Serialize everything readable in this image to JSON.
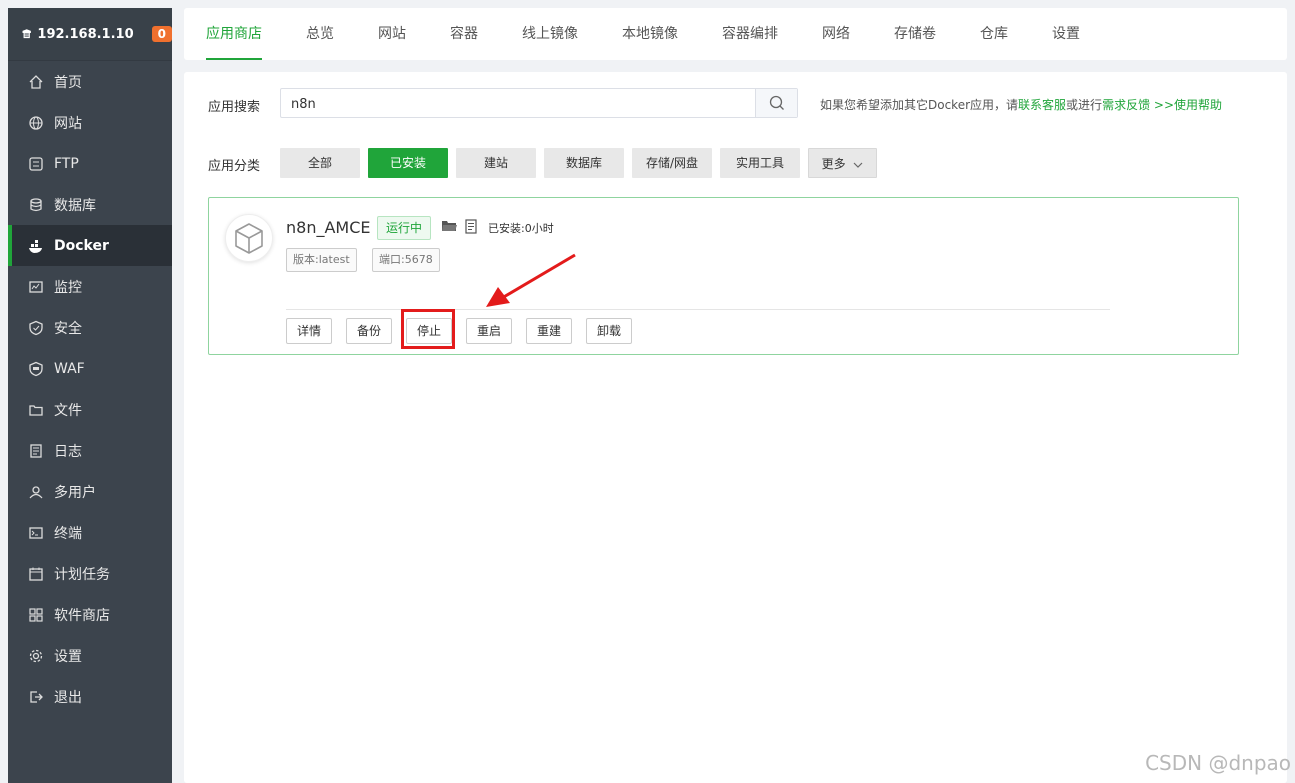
{
  "sidebar": {
    "ip": "192.168.1.10",
    "badge": "0",
    "items": [
      {
        "label": "首页",
        "icon": "home-icon"
      },
      {
        "label": "网站",
        "icon": "globe-icon"
      },
      {
        "label": "FTP",
        "icon": "ftp-icon"
      },
      {
        "label": "数据库",
        "icon": "database-icon"
      },
      {
        "label": "Docker",
        "icon": "docker-icon",
        "active": true
      },
      {
        "label": "监控",
        "icon": "monitor-icon"
      },
      {
        "label": "安全",
        "icon": "shield-icon"
      },
      {
        "label": "WAF",
        "icon": "waf-icon"
      },
      {
        "label": "文件",
        "icon": "folder-icon"
      },
      {
        "label": "日志",
        "icon": "log-icon"
      },
      {
        "label": "多用户",
        "icon": "users-icon"
      },
      {
        "label": "终端",
        "icon": "terminal-icon"
      },
      {
        "label": "计划任务",
        "icon": "calendar-icon"
      },
      {
        "label": "软件商店",
        "icon": "grid-icon"
      },
      {
        "label": "设置",
        "icon": "gear-icon"
      },
      {
        "label": "退出",
        "icon": "logout-icon"
      }
    ]
  },
  "tabs": [
    "应用商店",
    "总览",
    "网站",
    "容器",
    "线上镜像",
    "本地镜像",
    "容器编排",
    "网络",
    "存储卷",
    "仓库",
    "设置"
  ],
  "search": {
    "label": "应用搜索",
    "value": "n8n",
    "hint_prefix": "如果您希望添加其它Docker应用，请",
    "hint_link1": "联系客服",
    "hint_mid": "或进行",
    "hint_link2": "需求反馈",
    "hint_link3": ">>使用帮助"
  },
  "categories": {
    "label": "应用分类",
    "items": [
      "全部",
      "已安装",
      "建站",
      "数据库",
      "存储/网盘",
      "实用工具",
      "更多"
    ]
  },
  "app": {
    "name": "n8n_AMCE",
    "status": "运行中",
    "installed": "已安装:0小时",
    "version_tag": "版本:latest",
    "port_tag": "端口:5678",
    "actions": [
      "详情",
      "备份",
      "停止",
      "重启",
      "重建",
      "卸载"
    ]
  },
  "watermark": "CSDN @dnpao",
  "colors": {
    "accent": "#20a53a",
    "sidebar": "#3c444d",
    "highlight": "#e31b1b",
    "badge": "#f0702e"
  }
}
